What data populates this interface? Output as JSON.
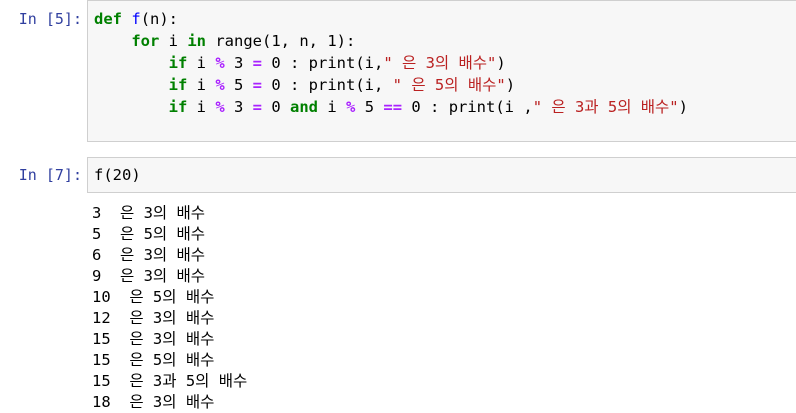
{
  "cell1": {
    "prompt": "In [5]:",
    "code": [
      [
        {
          "t": "def",
          "c": "kw"
        },
        {
          "t": " "
        },
        {
          "t": "f",
          "c": "fn"
        },
        {
          "t": "(n):"
        }
      ],
      [
        {
          "t": "    "
        },
        {
          "t": "for",
          "c": "kw"
        },
        {
          "t": " i "
        },
        {
          "t": "in",
          "c": "kw"
        },
        {
          "t": " range(1, n, 1):"
        }
      ],
      [
        {
          "t": "        "
        },
        {
          "t": "if",
          "c": "kw"
        },
        {
          "t": " i "
        },
        {
          "t": "%",
          "c": "op"
        },
        {
          "t": " 3 "
        },
        {
          "t": "=",
          "c": "op"
        },
        {
          "t": " 0 : print(i,"
        },
        {
          "t": "\" 은 3의 배수\"",
          "c": "str"
        },
        {
          "t": ")"
        }
      ],
      [
        {
          "t": "        "
        },
        {
          "t": "if",
          "c": "kw"
        },
        {
          "t": " i "
        },
        {
          "t": "%",
          "c": "op"
        },
        {
          "t": " 5 "
        },
        {
          "t": "=",
          "c": "op"
        },
        {
          "t": " 0 : print(i, "
        },
        {
          "t": "\" 은 5의 배수\"",
          "c": "str"
        },
        {
          "t": ")"
        }
      ],
      [
        {
          "t": "        "
        },
        {
          "t": "if",
          "c": "kw"
        },
        {
          "t": " i "
        },
        {
          "t": "%",
          "c": "op"
        },
        {
          "t": " 3 "
        },
        {
          "t": "=",
          "c": "op"
        },
        {
          "t": " 0 "
        },
        {
          "t": "and",
          "c": "kw"
        },
        {
          "t": " i "
        },
        {
          "t": "%",
          "c": "op"
        },
        {
          "t": " 5 "
        },
        {
          "t": "==",
          "c": "op"
        },
        {
          "t": " 0 : print(i ,"
        },
        {
          "t": "\" 은 3과 5의 배수\"",
          "c": "str"
        },
        {
          "t": ")"
        }
      ]
    ]
  },
  "cell2": {
    "prompt": "In [7]:",
    "code": [
      [
        {
          "t": "f(20)"
        }
      ]
    ],
    "output": [
      "3  은 3의 배수",
      "5  은 5의 배수",
      "6  은 3의 배수",
      "9  은 3의 배수",
      "10  은 5의 배수",
      "12  은 3의 배수",
      "15  은 3의 배수",
      "15  은 5의 배수",
      "15  은 3과 5의 배수",
      "18  은 3의 배수"
    ]
  },
  "colors": {
    "keyword": "#008000",
    "operator": "#aa22ff",
    "string": "#ba2121",
    "prompt": "#303f9f",
    "cell_bg": "#f7f7f7"
  }
}
